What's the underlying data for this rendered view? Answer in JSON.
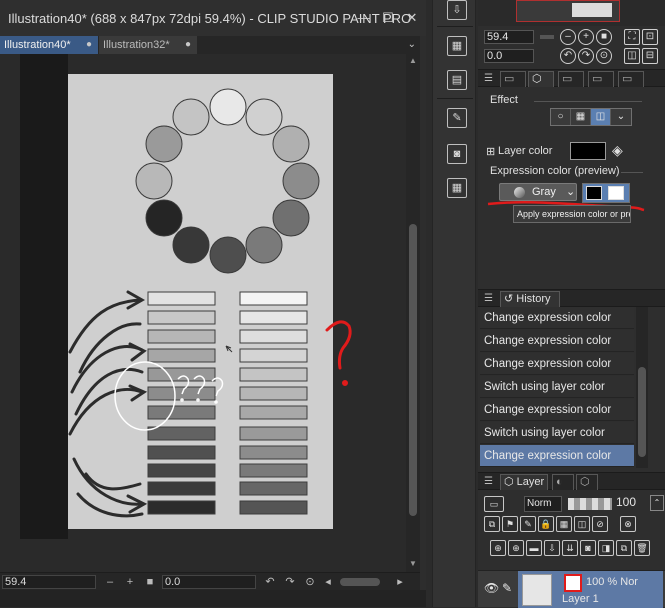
{
  "window": {
    "title": "Illustration40* (688 x 847px 72dpi 59.4%) - CLIP STUDIO PAINT PRO",
    "minimize": "—",
    "maximize": "☐",
    "close": "✕"
  },
  "tabs": [
    {
      "label": "Illustration40*",
      "active": true
    },
    {
      "label": "Illustration32*",
      "active": false
    }
  ],
  "tab_close_glyph": "●",
  "tab_more_glyph": "⌄",
  "status": {
    "zoom": "59.4",
    "angle": "0.0",
    "zoom_out": "–",
    "zoom_in": "+"
  },
  "navigator": {
    "zoom": "59.4",
    "angle": "0.0"
  },
  "tool_property": {
    "effect_label": "Effect",
    "layer_color_label": "Layer color",
    "expression_color_label": "Expression color (preview)",
    "expression_color_value": "Gray",
    "tooltip": "Apply expression color or previe",
    "layer_color_swatch": "#000000"
  },
  "history": {
    "tab_label": "History",
    "items": [
      "Change expression color",
      "Change expression color",
      "Change expression color",
      "Switch using layer color",
      "Change expression color",
      "Switch using layer color",
      "Change expression color"
    ],
    "selected_index": 6
  },
  "layer_panel": {
    "tab_label": "Layer",
    "blend_mode": "Norm",
    "opacity": "100",
    "layer_opacity_mode": "100 % Nor",
    "layer_name": "Layer 1"
  },
  "colors": {
    "accent": "#5d79a5",
    "canvas_paper": "#cfcfcf",
    "annotation_red": "#e01b1b"
  }
}
